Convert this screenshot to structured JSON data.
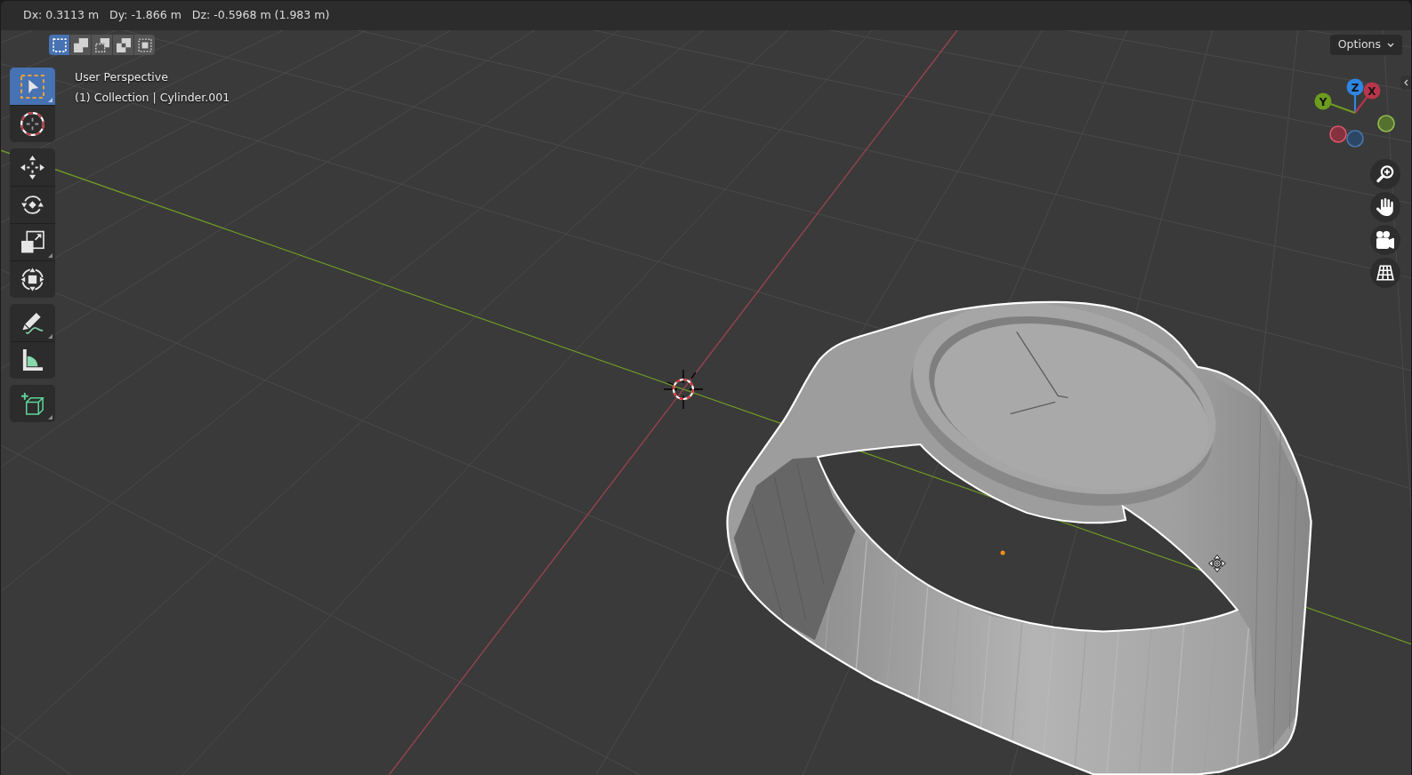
{
  "header": {
    "readouts": [
      "Dx: 0.3113 m",
      "Dy: -1.866 m",
      "Dz: -0.5968 m (1.983 m)"
    ]
  },
  "select_modes": [
    {
      "kind": "set",
      "selected": true
    },
    {
      "kind": "extend",
      "selected": false
    },
    {
      "kind": "subtract",
      "selected": false
    },
    {
      "kind": "invert",
      "selected": false
    },
    {
      "kind": "intersect",
      "selected": false
    }
  ],
  "toolbar": [
    {
      "tools": [
        {
          "kind": "select_box",
          "selected": true,
          "flyout": true
        },
        {
          "kind": "cursor",
          "selected": false,
          "flyout": false
        }
      ]
    },
    {
      "tools": [
        {
          "kind": "move",
          "selected": false,
          "flyout": false
        },
        {
          "kind": "rotate",
          "selected": false,
          "flyout": false
        },
        {
          "kind": "scale",
          "selected": false,
          "flyout": true
        },
        {
          "kind": "transform",
          "selected": false,
          "flyout": false
        }
      ]
    },
    {
      "tools": [
        {
          "kind": "annotate",
          "selected": false,
          "flyout": true
        },
        {
          "kind": "measure",
          "selected": false,
          "flyout": false
        }
      ]
    },
    {
      "tools": [
        {
          "kind": "add_cube",
          "selected": false,
          "flyout": true
        }
      ]
    }
  ],
  "viewport_info": {
    "view": "User Perspective",
    "context": "(1) Collection | Cylinder.001"
  },
  "options": {
    "label": "Options"
  },
  "gizmo": {
    "axes": [
      {
        "kind": "positive",
        "label": "Z",
        "color": "#2f86e0"
      },
      {
        "kind": "positive",
        "label": "X",
        "color": "#b8364b"
      },
      {
        "kind": "positive",
        "label": "Y",
        "color": "#6c9c1e"
      },
      {
        "kind": "negative",
        "color": "#56702f"
      },
      {
        "kind": "negative",
        "color": "#84323f"
      },
      {
        "kind": "negative",
        "color": "#2c4665"
      }
    ]
  },
  "navigation": [
    {
      "kind": "zoom"
    },
    {
      "kind": "pan"
    },
    {
      "kind": "camera"
    },
    {
      "kind": "projection"
    }
  ]
}
